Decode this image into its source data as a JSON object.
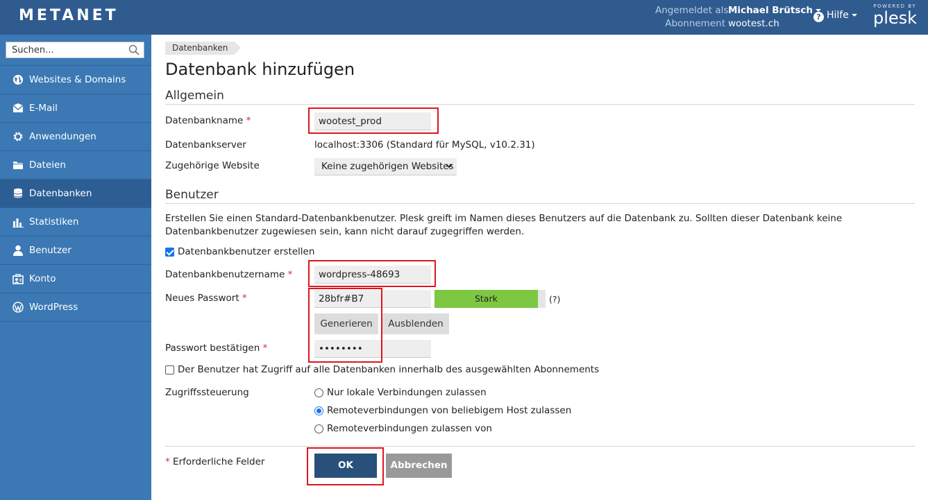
{
  "header": {
    "logo": "METANET",
    "logged_in_label": "Angemeldet als",
    "user_name": "Michael Brütsch",
    "subscription_label": "Abonnement",
    "subscription_value": "wootest.ch",
    "help_label": "Hilfe",
    "powered_by": "POWERED BY",
    "plesk": "plesk"
  },
  "sidebar": {
    "search_placeholder": "Suchen...",
    "items": [
      {
        "label": "Websites & Domains",
        "icon": "globe-icon"
      },
      {
        "label": "E-Mail",
        "icon": "mail-icon"
      },
      {
        "label": "Anwendungen",
        "icon": "gear-icon"
      },
      {
        "label": "Dateien",
        "icon": "folder-icon"
      },
      {
        "label": "Datenbanken",
        "icon": "database-icon",
        "active": true
      },
      {
        "label": "Statistiken",
        "icon": "bar-chart-icon"
      },
      {
        "label": "Benutzer",
        "icon": "user-icon"
      },
      {
        "label": "Konto",
        "icon": "account-icon"
      },
      {
        "label": "WordPress",
        "icon": "wordpress-icon"
      }
    ]
  },
  "breadcrumb": "Datenbanken",
  "page_title": "Datenbank hinzufügen",
  "sections": {
    "general": "Allgemein",
    "users": "Benutzer"
  },
  "form": {
    "db_name_label": "Datenbankname",
    "db_name_value": "wootest_prod",
    "db_server_label": "Datenbankserver",
    "db_server_value": "localhost:3306 (Standard für MySQL, v10.2.31)",
    "website_label": "Zugehörige Website",
    "website_value": "Keine zugehörigen Websites",
    "user_description": "Erstellen Sie einen Standard-Datenbankbenutzer. Plesk greift im Namen dieses Benutzers auf die Datenbank zu. Sollten dieser Datenbank keine Datenbankbenutzer zugewiesen sein, kann nicht darauf zugegriffen werden.",
    "create_user_label": "Datenbankbenutzer erstellen",
    "create_user_checked": true,
    "username_label": "Datenbankbenutzername",
    "username_value": "wordpress-48693",
    "password_label": "Neues Passwort",
    "password_value": "28bfr#B7",
    "strength_label": "Stark",
    "strength_level": 0.93,
    "help_hint": "(?)",
    "generate_label": "Generieren",
    "hide_label": "Ausblenden",
    "confirm_label": "Passwort bestätigen",
    "confirm_value": "••••••••",
    "all_db_access_label": "Der Benutzer hat Zugriff auf alle Datenbanken innerhalb des ausgewählten Abonnements",
    "all_db_access_checked": false,
    "access_control_label": "Zugriffssteuerung",
    "access_options": [
      {
        "label": "Nur lokale Verbindungen zulassen",
        "checked": false
      },
      {
        "label": "Remoteverbindungen von beliebigem Host zulassen",
        "checked": true
      },
      {
        "label": "Remoteverbindungen zulassen von",
        "checked": false
      }
    ],
    "required_asterisk": "*",
    "required_note": "Erforderliche Felder",
    "ok_label": "OK",
    "cancel_label": "Abbrechen"
  },
  "colors": {
    "header_bg": "#2f5b8f",
    "sidebar_bg": "#3b78b4",
    "strength_green": "#7dc742",
    "ok_button": "#28507a",
    "highlight_red": "#e0141e"
  }
}
